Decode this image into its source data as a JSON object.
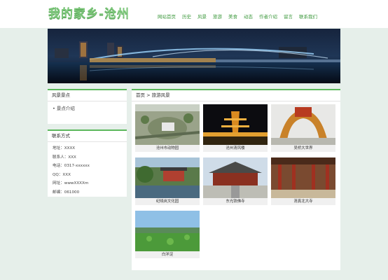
{
  "site": {
    "logo": "我的家乡-沧州",
    "nav": [
      "网站首页",
      "历史",
      "风景",
      "旅游",
      "美食",
      "动态",
      "作者介绍",
      "留言",
      "联系我们"
    ]
  },
  "sidebar": {
    "scenic": {
      "title": "风景景点",
      "item": "景点介绍"
    },
    "contact": {
      "title": "联系方式",
      "lines": [
        "地址：XXXX",
        "联系人：XXX",
        "电话：0317-xxxxxx",
        "QQ：XXX",
        "网址：wwwXXXXm",
        "邮编：061000"
      ]
    }
  },
  "main": {
    "breadcrumb": "首页 > 旅游风景",
    "gallery": [
      {
        "caption": "沧州市动物园",
        "icon": "zoo-aerial-photo"
      },
      {
        "caption": "沧州清风楼",
        "icon": "night-tower-photo"
      },
      {
        "caption": "吴桥大世界",
        "icon": "arch-gate-photo"
      },
      {
        "caption": "纪晓岚文化园",
        "icon": "garden-photo"
      },
      {
        "caption": "东光铁佛寺",
        "icon": "temple-photo"
      },
      {
        "caption": "清真北大寺",
        "icon": "mosque-hall-photo"
      },
      {
        "caption": "白洋淀",
        "icon": "lotus-lake-photo"
      }
    ]
  },
  "colors": {
    "accent": "#5cb85c",
    "nav_text": "#3f9a3f",
    "page_bg": "#e6efea"
  }
}
